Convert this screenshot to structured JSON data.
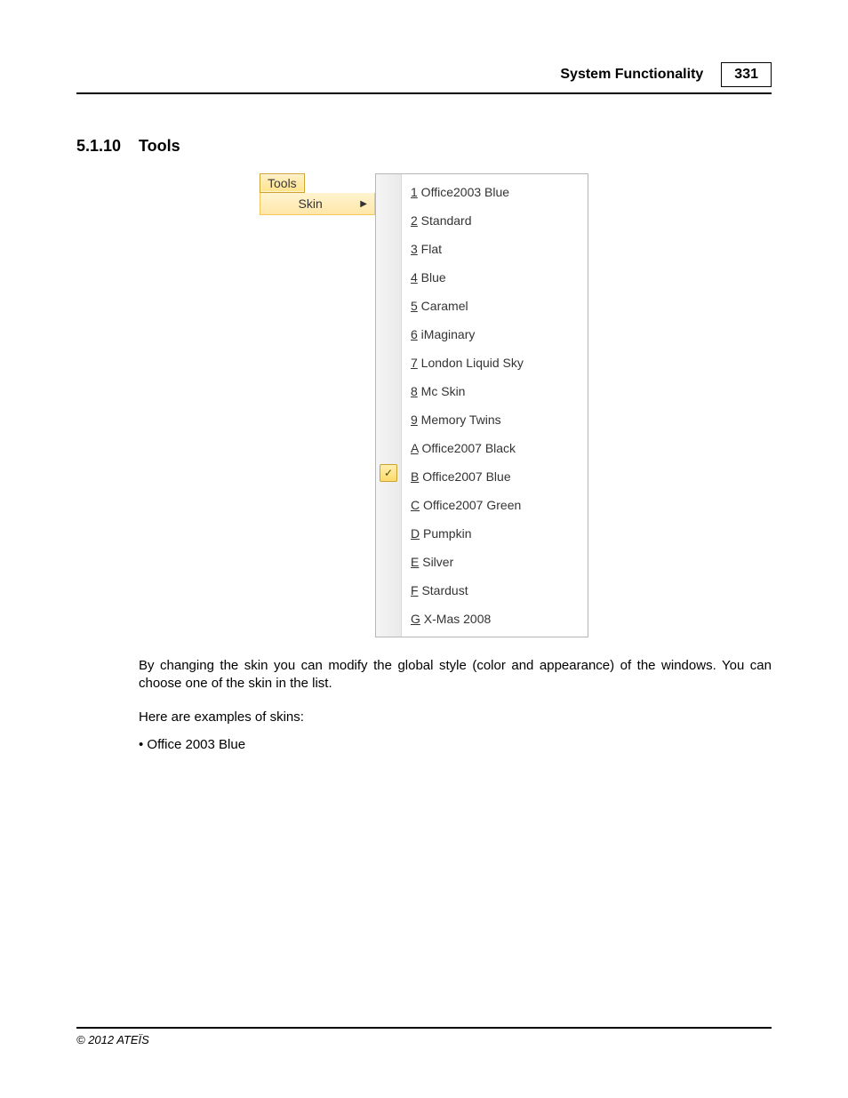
{
  "header": {
    "title": "System Functionality",
    "page_number": "331"
  },
  "section": {
    "number": "5.1.10",
    "title": "Tools"
  },
  "menu": {
    "tools_label": "Tools",
    "skin_label": "Skin",
    "items": [
      {
        "accel": "1",
        "label": "Office2003 Blue",
        "checked": false
      },
      {
        "accel": "2",
        "label": "Standard",
        "checked": false
      },
      {
        "accel": "3",
        "label": "Flat",
        "checked": false
      },
      {
        "accel": "4",
        "label": "Blue",
        "checked": false
      },
      {
        "accel": "5",
        "label": "Caramel",
        "checked": false
      },
      {
        "accel": "6",
        "label": "iMaginary",
        "checked": false
      },
      {
        "accel": "7",
        "label": "London Liquid Sky",
        "checked": false
      },
      {
        "accel": "8",
        "label": "Mc Skin",
        "checked": false
      },
      {
        "accel": "9",
        "label": "Memory Twins",
        "checked": false
      },
      {
        "accel": "A",
        "label": "Office2007 Black",
        "checked": false
      },
      {
        "accel": "B",
        "label": "Office2007 Blue",
        "checked": true
      },
      {
        "accel": "C",
        "label": "Office2007 Green",
        "checked": false
      },
      {
        "accel": "D",
        "label": "Pumpkin",
        "checked": false
      },
      {
        "accel": "E",
        "label": "Silver",
        "checked": false
      },
      {
        "accel": "F",
        "label": "Stardust",
        "checked": false
      },
      {
        "accel": "G",
        "label": "X-Mas 2008",
        "checked": false
      }
    ]
  },
  "paragraphs": {
    "p1": "By changing the skin you can modify the global style (color and appearance) of the windows. You can choose one of the skin in the list.",
    "p2": "Here are examples of skins:",
    "bullet1": "Office 2003 Blue"
  },
  "footer": {
    "copyright": "© 2012 ATEÏS"
  }
}
